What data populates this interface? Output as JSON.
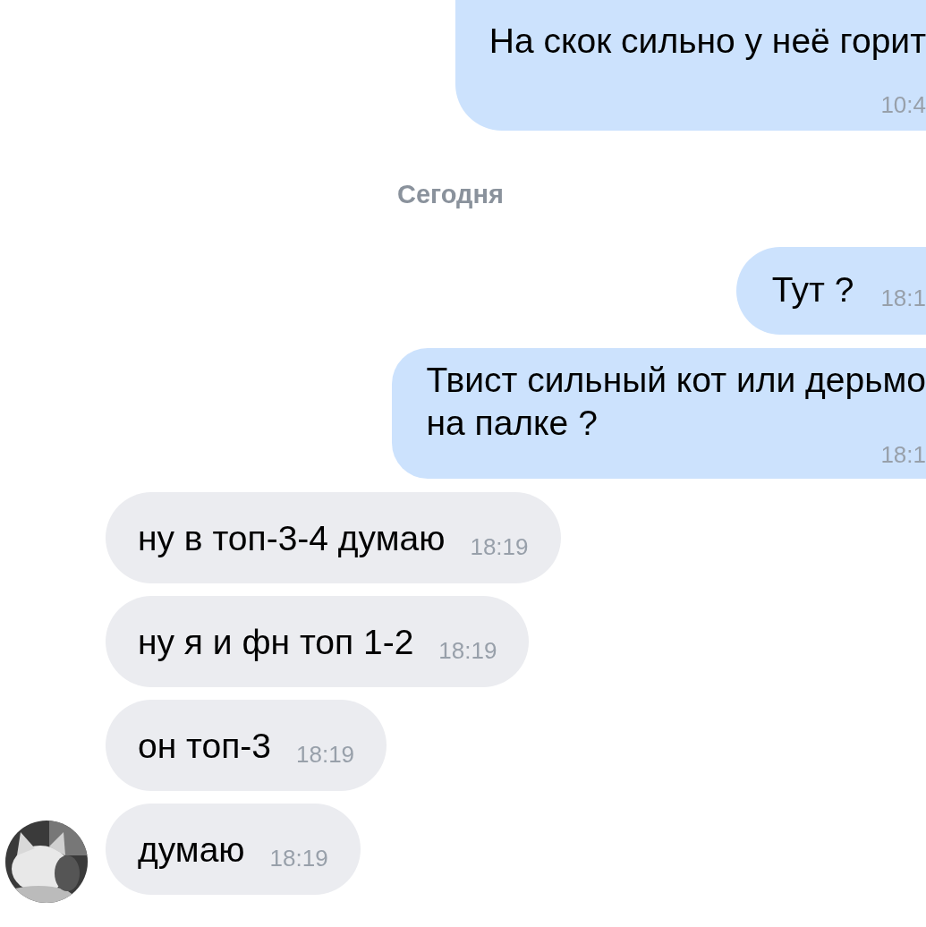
{
  "messages": [
    {
      "kind": "outgoing",
      "lines": [
        "На скок сильно у неё горит"
      ],
      "time": "10:4"
    },
    {
      "kind": "date",
      "text": "Сегодня"
    },
    {
      "kind": "outgoing",
      "lines": [
        "Тут ?"
      ],
      "time": "18:1"
    },
    {
      "kind": "outgoing",
      "lines": [
        "Твист сильный кот или дерьмо",
        "на палке ?"
      ],
      "time": "18:1"
    },
    {
      "kind": "incoming",
      "lines": [
        "ну в топ-3-4 думаю"
      ],
      "time": "18:19",
      "avatar": false
    },
    {
      "kind": "incoming",
      "lines": [
        "ну я и фн топ 1-2"
      ],
      "time": "18:19",
      "avatar": false
    },
    {
      "kind": "incoming",
      "lines": [
        "он топ-3"
      ],
      "time": "18:19",
      "avatar": false
    },
    {
      "kind": "incoming",
      "lines": [
        "думаю"
      ],
      "time": "18:19",
      "avatar": true
    }
  ]
}
